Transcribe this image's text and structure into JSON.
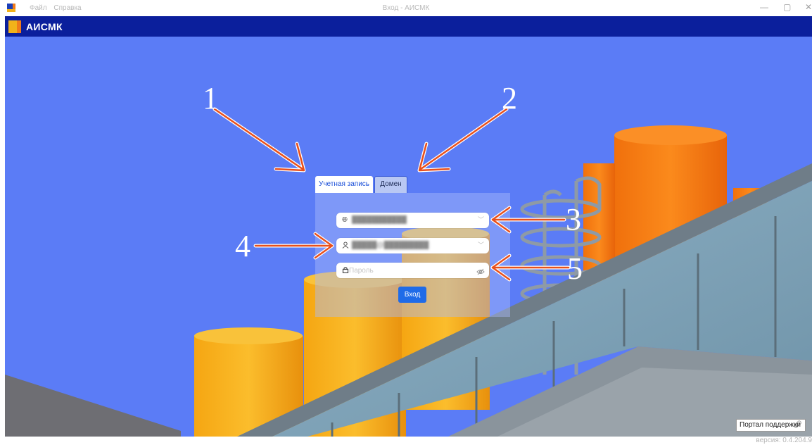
{
  "window": {
    "menu": [
      "Файл",
      "Справка"
    ],
    "title": "Вход - АИСМК",
    "controls": {
      "minimize": "—",
      "maximize": "▢",
      "close": "✕"
    }
  },
  "app": {
    "name": "АИСМК"
  },
  "login": {
    "tabs": [
      {
        "label": "Учетная запись",
        "active": true
      },
      {
        "label": "Домен",
        "active": false
      }
    ],
    "server_field": {
      "icon": "globe-icon",
      "value": "███████████"
    },
    "user_field": {
      "icon": "user-icon",
      "value": "█████@█████████"
    },
    "password_field": {
      "icon": "lock-icon",
      "placeholder": "Пароль"
    },
    "submit_label": "Вход"
  },
  "annotations": [
    "1",
    "2",
    "3",
    "4",
    "5"
  ],
  "footer": {
    "support_label": "Портал поддержки",
    "support_icon": "link-icon",
    "version": "версия: 0.4.204.9"
  },
  "colors": {
    "header": "#0b1f9c",
    "sky": "#5b7cf6",
    "accent": "#1f6be8",
    "annotation_arrow": "#e8501c"
  }
}
